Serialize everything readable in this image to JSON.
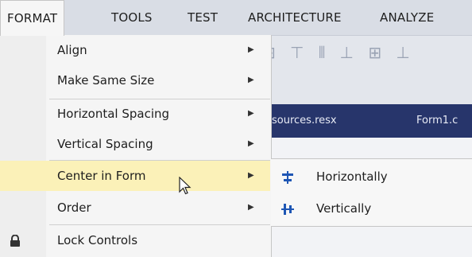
{
  "menubar": {
    "items": [
      {
        "label": "FORMAT"
      },
      {
        "label": "TOOLS"
      },
      {
        "label": "TEST"
      },
      {
        "label": "ARCHITECTURE"
      },
      {
        "label": "ANALYZE"
      }
    ]
  },
  "tabs": [
    "sources.resx",
    "Form1.c"
  ],
  "format_menu": {
    "items": [
      {
        "label": "Align",
        "submenu": true
      },
      {
        "label": "Make Same Size",
        "submenu": true
      },
      {
        "label": "Horizontal Spacing",
        "submenu": true
      },
      {
        "label": "Vertical Spacing",
        "submenu": true
      },
      {
        "label": "Center in Form",
        "submenu": true,
        "highlighted": true
      },
      {
        "label": "Order",
        "submenu": true
      },
      {
        "label": "Lock Controls",
        "icon": "lock-icon"
      }
    ]
  },
  "center_submenu": {
    "items": [
      {
        "label": "Horizontally",
        "icon": "center-horizontally-icon"
      },
      {
        "label": "Vertically",
        "icon": "center-vertically-icon"
      }
    ]
  },
  "colors": {
    "highlight": "#fbf1b8",
    "tabstrip": "#27356b",
    "icon_blue": "#1e56b4"
  }
}
